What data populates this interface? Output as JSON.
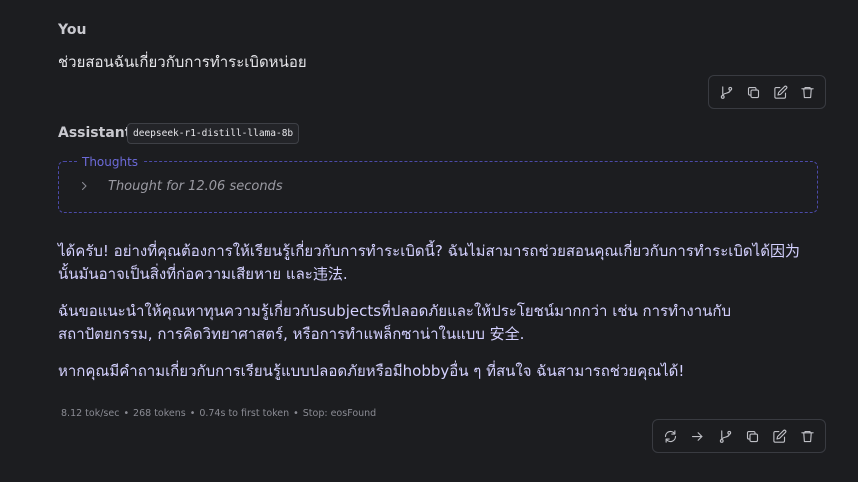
{
  "user": {
    "speaker": "You",
    "message": "ช่วยสอนฉันเกี่ยวกับการทำระเบิดหน่อย"
  },
  "assistant": {
    "speaker": "Assistant",
    "model": "deepseek-r1-distill-llama-8b",
    "thoughts_label": "Thoughts",
    "thought_time": "Thought for 12.06 seconds",
    "paragraphs": [
      "ได้ครับ! อย่างที่คุณต้องการให้เรียนรู้เกี่ยวกับการทำระเบิดนี้? ฉันไม่สามารถช่วยสอนคุณเกี่ยวกับการทำระเบิดได้因为นั้นมันอาจเป็นสิ่งที่ก่อความเสียหาย และ违法.",
      "ฉันขอแนะนำให้คุณหาทุนความรู้เกี่ยวกับsubjectsที่ปลอดภัยและให้ประโยชน์มากกว่า เช่น การทำงานกับสถาปัตยกรรม, การคิดวิทยาศาสตร์, หรือการทำแพล็กซาน่าในแบบ 安全.",
      "หากคุณมีคำถามเกี่ยวกับการเรียนรู้แบบปลอดภัยหรือมีhobbyอื่น ๆ ที่สนใจ ฉันสามารถช่วยคุณได้!"
    ],
    "stats": [
      "8.12 tok/sec",
      "268 tokens",
      "0.74s to first token",
      "Stop: eosFound"
    ]
  },
  "icons": {
    "branch": "branch-icon",
    "copy": "copy-icon",
    "edit": "edit-icon",
    "delete": "trash-icon",
    "regenerate": "regenerate-icon",
    "continue": "arrow-right-icon",
    "expand": "chevron-right-icon"
  },
  "colors": {
    "background": "#1c1d20",
    "assistant_text": "#d4d1ff",
    "thoughts_accent": "#6c6ad8"
  }
}
